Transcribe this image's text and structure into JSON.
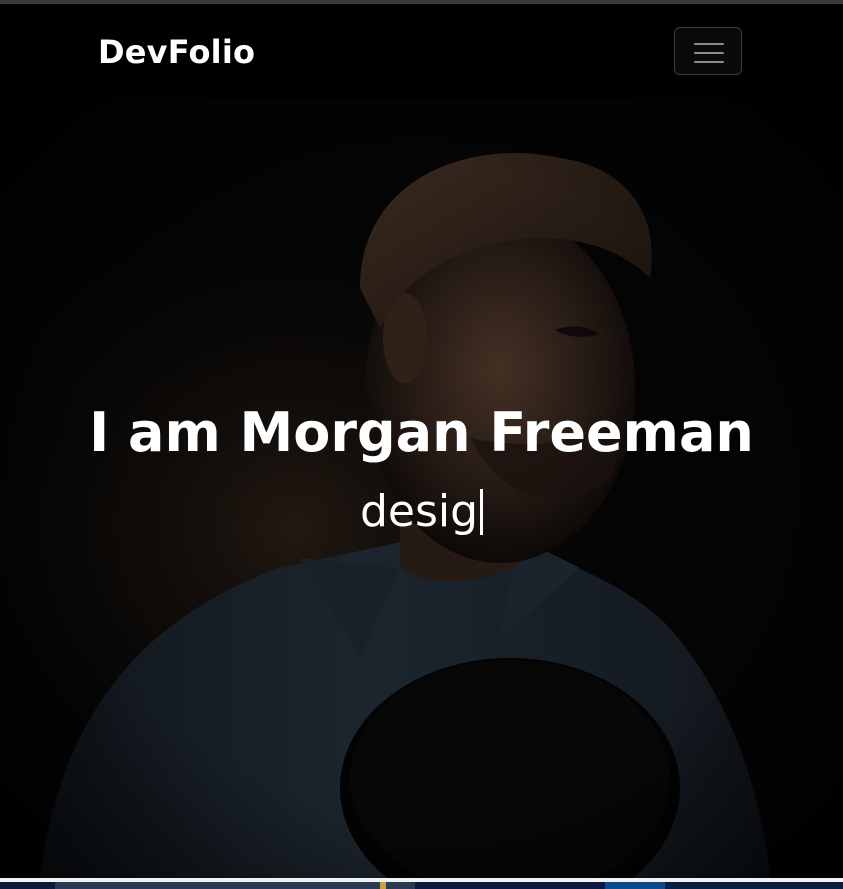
{
  "navbar": {
    "brand": "DevFolio",
    "toggler_icon": "hamburger-menu-icon"
  },
  "hero": {
    "title": "I am Morgan Freeman",
    "typed_text": "desig",
    "background_image": "portrait-man-hat-photo"
  },
  "colors": {
    "navbar_bg": "#000000",
    "text": "#ffffff",
    "toggler_border": "#3a3a3a",
    "toggler_bars": "#8c8c8c"
  }
}
